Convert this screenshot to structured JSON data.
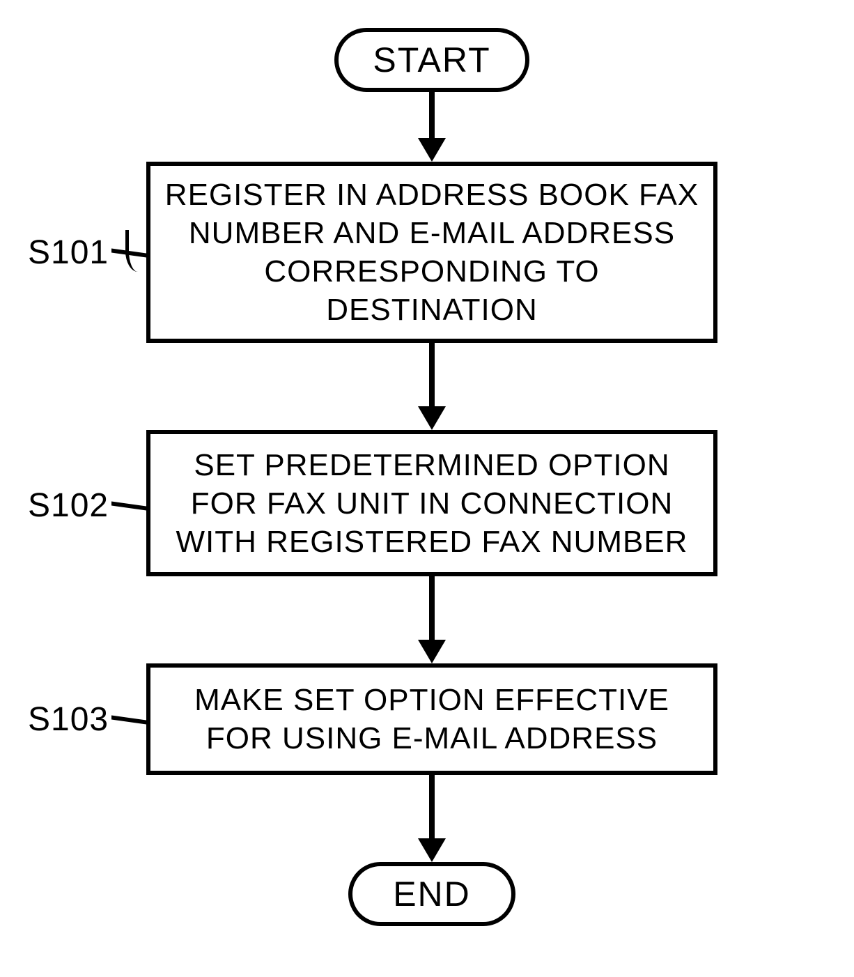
{
  "chart_data": {
    "type": "flowchart",
    "title": "",
    "nodes": [
      {
        "id": "start",
        "kind": "terminator",
        "label": "START"
      },
      {
        "id": "s101",
        "kind": "process",
        "step": "S101",
        "label": "REGISTER IN ADDRESS BOOK FAX NUMBER AND E-MAIL ADDRESS CORRESPONDING TO DESTINATION"
      },
      {
        "id": "s102",
        "kind": "process",
        "step": "S102",
        "label": "SET PREDETERMINED OPTION FOR FAX UNIT IN CONNECTION WITH REGISTERED FAX NUMBER"
      },
      {
        "id": "s103",
        "kind": "process",
        "step": "S103",
        "label": "MAKE SET OPTION EFFECTIVE FOR USING E-MAIL ADDRESS"
      },
      {
        "id": "end",
        "kind": "terminator",
        "label": "END"
      }
    ],
    "edges": [
      {
        "from": "start",
        "to": "s101"
      },
      {
        "from": "s101",
        "to": "s102"
      },
      {
        "from": "s102",
        "to": "s103"
      },
      {
        "from": "s103",
        "to": "end"
      }
    ]
  },
  "palette": {
    "stroke": "#000000",
    "bg": "#ffffff"
  }
}
